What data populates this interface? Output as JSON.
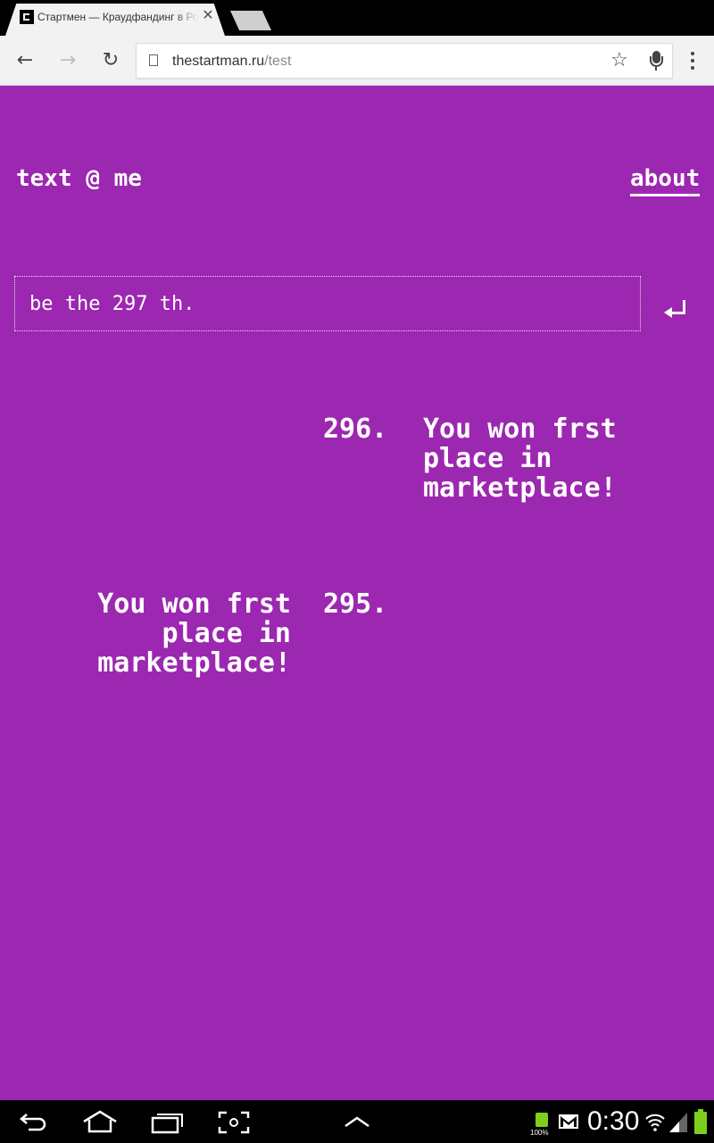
{
  "browser": {
    "tab_title": "Стартмен — Краудфандинг в Ро",
    "url_host": "thestartman.ru",
    "url_path": "/test"
  },
  "page": {
    "logo": "text @ me",
    "about_link": "about",
    "input_placeholder": "be the 297 th."
  },
  "messages": [
    {
      "number": "296.",
      "lines": [
        "You won frst",
        "place in",
        "marketplace!"
      ],
      "side": "right"
    },
    {
      "number": "295.",
      "lines": [
        "You won frst",
        "place in",
        "marketplace!"
      ],
      "side": "left"
    }
  ],
  "system": {
    "battery_percent": "100%",
    "time": "0:30"
  },
  "colors": {
    "page_background": "#9c27b0",
    "battery": "#7ecf1b"
  },
  "icons": [
    "back-arrow-icon",
    "forward-arrow-icon",
    "reload-icon",
    "page-icon",
    "bookmark-star-icon",
    "microphone-icon",
    "menu-dots-icon",
    "enter-arrow-icon",
    "nav-back-icon",
    "nav-home-icon",
    "nav-recent-apps-icon",
    "screenshot-icon",
    "nav-up-chevron-icon",
    "battery-charging-icon",
    "gmail-icon",
    "wifi-icon",
    "signal-icon",
    "battery-icon"
  ]
}
